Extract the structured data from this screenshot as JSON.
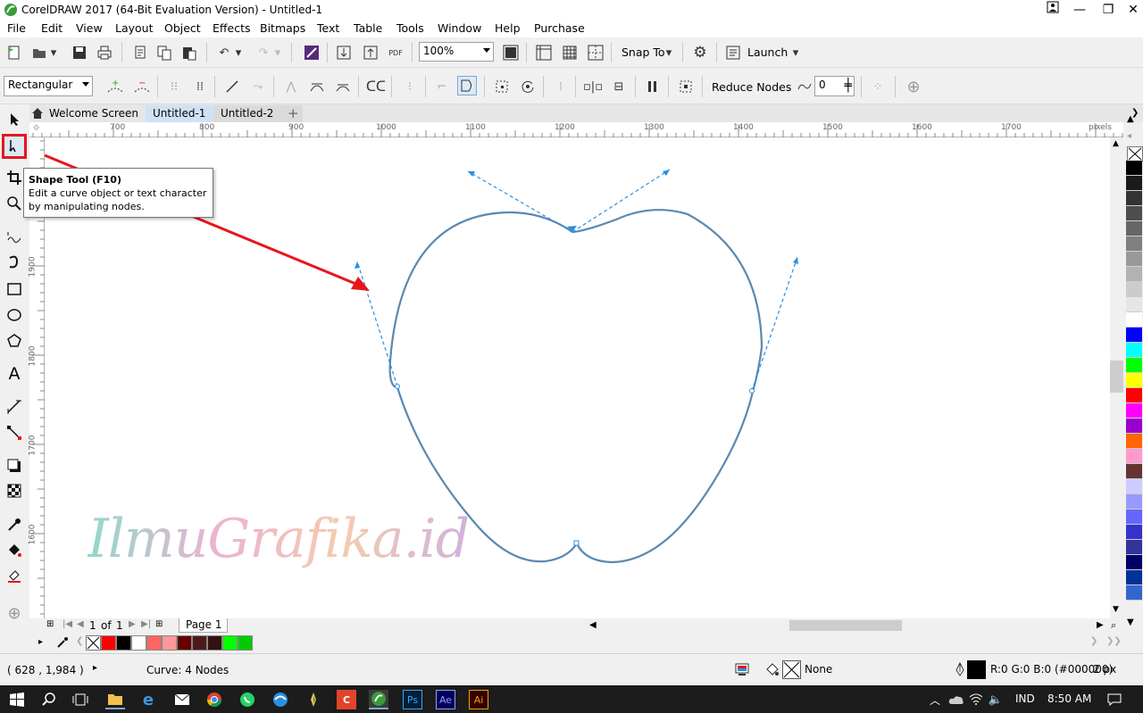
{
  "app": {
    "title": "CorelDRAW 2017 (64-Bit Evaluation Version) - Untitled-1"
  },
  "menu": [
    "File",
    "Edit",
    "View",
    "Layout",
    "Object",
    "Effects",
    "Bitmaps",
    "Text",
    "Table",
    "Tools",
    "Window",
    "Help",
    "Purchase"
  ],
  "standard_toolbar": {
    "zoom_value": "100%",
    "snap_to_label": "Snap To",
    "launch_label": "Launch"
  },
  "property_bar": {
    "selection_mode": "Rectangular",
    "reduce_nodes_label": "Reduce Nodes",
    "curve_smoothness": "0"
  },
  "tabs": {
    "welcome": "Welcome Screen",
    "doc1": "Untitled-1",
    "doc2": "Untitled-2"
  },
  "ruler": {
    "units": "pixels",
    "h_ticks": [
      "700",
      "800",
      "900",
      "1000",
      "1100",
      "1200",
      "1300",
      "1400",
      "1500",
      "1600",
      "1700"
    ],
    "v_ticks": [
      "1900",
      "1800",
      "1700",
      "1600"
    ]
  },
  "tooltip": {
    "title": "Shape Tool (F10)",
    "body": "Edit a curve object or text character by manipulating nodes."
  },
  "watermark": "IlmuGrafika.id",
  "page_nav": {
    "current": "1",
    "of_label": "of",
    "total": "1",
    "page_tab": "Page 1"
  },
  "status": {
    "coordinates": "( 628 , 1,984 )",
    "selection_info": "Curve: 4 Nodes",
    "fill_label": "None",
    "outline_color": "R:0 G:0 B:0 (#000000)",
    "outline_width": "2 px"
  },
  "taskbar": {
    "language": "IND",
    "time": "8:50 AM"
  },
  "colors": {
    "accent_curve": "#5b88b0",
    "arrow": "#e8161b",
    "control_handle": "#2a8fe0"
  },
  "palette": [
    "#000000",
    "#1a1a1a",
    "#333333",
    "#4d4d4d",
    "#666666",
    "#808080",
    "#999999",
    "#b3b3b3",
    "#cccccc",
    "#e6e6e6",
    "#ffffff",
    "#0000ff",
    "#00ffff",
    "#00ff00",
    "#ffff00",
    "#ff0000",
    "#ff00ff",
    "#9900cc",
    "#ff6600",
    "#ff99cc",
    "#663333",
    "#ccccff",
    "#9999ff",
    "#6666ff",
    "#3333cc",
    "#333399",
    "#000066",
    "#003399",
    "#3366cc"
  ],
  "doc_palette": [
    "#ff0000",
    "#000000",
    "#ffffff",
    "#ff6666",
    "#ff9999",
    "#660000",
    "#4d1a1a",
    "#331111",
    "#00ff00",
    "#00cc00"
  ]
}
